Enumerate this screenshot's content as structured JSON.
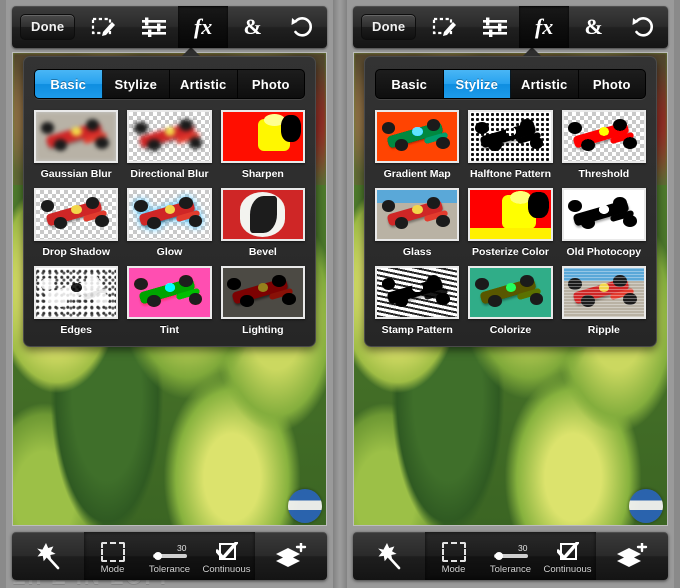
{
  "app": {
    "watermark": "LIFE IN LOFI"
  },
  "toolbar": {
    "done_label": "Done",
    "items": [
      {
        "name": "selection-pencil-icon",
        "label": "Selection"
      },
      {
        "name": "adjustments-icon",
        "label": "Adjustments"
      },
      {
        "name": "fx-icon",
        "label": "fx",
        "glyph": "fx"
      },
      {
        "name": "blend-icon",
        "label": "Blend",
        "glyph": "&"
      },
      {
        "name": "undo-icon",
        "label": "Undo"
      }
    ]
  },
  "bottombar": {
    "wand_label": "Magic Wand",
    "mode_label": "Mode",
    "tolerance_label": "Tolerance",
    "tolerance_value": "30",
    "continuous_label": "Continuous",
    "layers_label": "Add Layer"
  },
  "panels": [
    {
      "id": "left",
      "tabs": [
        {
          "label": "Basic",
          "active": true
        },
        {
          "label": "Stylize",
          "active": false
        },
        {
          "label": "Artistic",
          "active": false
        },
        {
          "label": "Photo",
          "active": false
        }
      ],
      "filters": [
        {
          "label": "Gaussian Blur",
          "art": "blur"
        },
        {
          "label": "Directional Blur",
          "art": "dblur"
        },
        {
          "label": "Sharpen",
          "art": "sharpen"
        },
        {
          "label": "Drop Shadow",
          "art": "dropshadow"
        },
        {
          "label": "Glow",
          "art": "glow"
        },
        {
          "label": "Bevel",
          "art": "bevel"
        },
        {
          "label": "Edges",
          "art": "edges"
        },
        {
          "label": "Tint",
          "art": "tint"
        },
        {
          "label": "Lighting",
          "art": "lighting"
        }
      ]
    },
    {
      "id": "right",
      "tabs": [
        {
          "label": "Basic",
          "active": false
        },
        {
          "label": "Stylize",
          "active": true
        },
        {
          "label": "Artistic",
          "active": false
        },
        {
          "label": "Photo",
          "active": false
        }
      ],
      "filters": [
        {
          "label": "Gradient Map",
          "art": "gradientmap"
        },
        {
          "label": "Halftone Pattern",
          "art": "halftone"
        },
        {
          "label": "Threshold",
          "art": "threshold"
        },
        {
          "label": "Glass",
          "art": "glass"
        },
        {
          "label": "Posterize Color",
          "art": "posterize"
        },
        {
          "label": "Old Photocopy",
          "art": "photocopy"
        },
        {
          "label": "Stamp Pattern",
          "art": "stamp"
        },
        {
          "label": "Colorize",
          "art": "colorize"
        },
        {
          "label": "Ripple",
          "art": "ripple"
        }
      ]
    }
  ],
  "colors": {
    "accent": "#27a2ef",
    "panel_bg": "#2e2e2e",
    "toolbar_bg": "#222222",
    "page_bg": "#8c8c8c"
  }
}
